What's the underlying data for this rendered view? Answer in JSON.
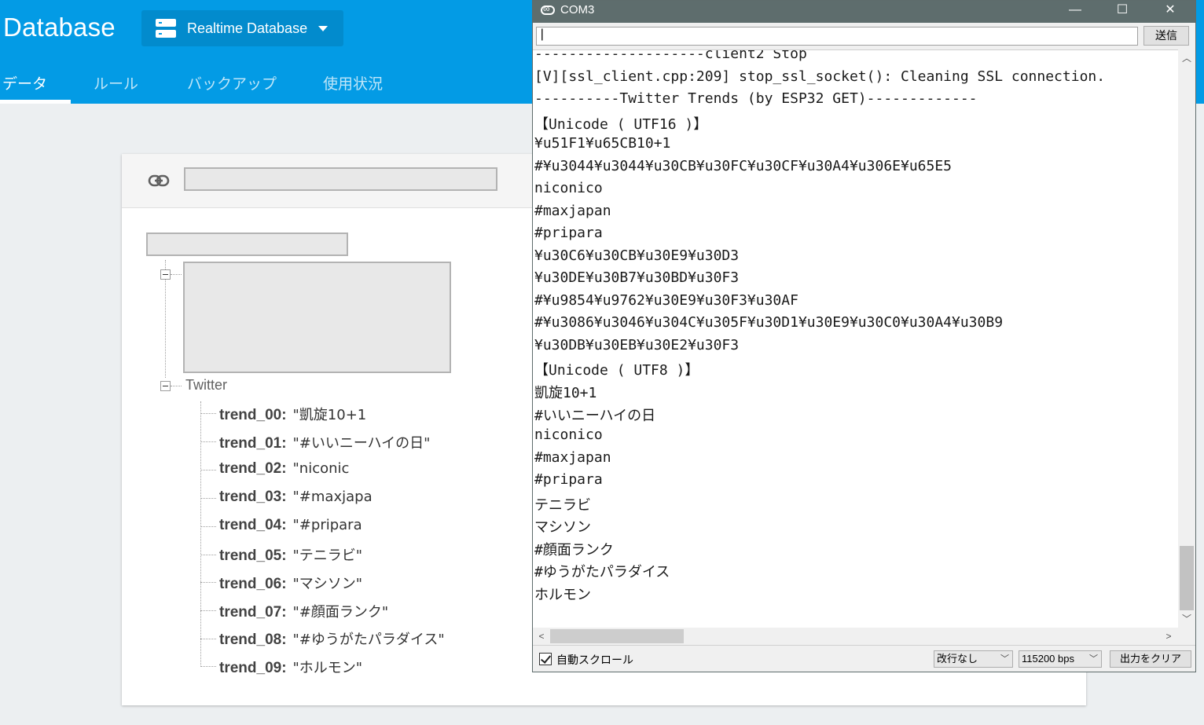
{
  "header": {
    "title": "Database",
    "db_selector": "Realtime Database",
    "tabs": [
      "データ",
      "ルール",
      "バックアップ",
      "使用状況"
    ],
    "active_tab": "データ"
  },
  "tree": {
    "node_name": "Twitter",
    "trends": [
      {
        "key": "trend_00:",
        "value": "\"凱旋10+1"
      },
      {
        "key": "trend_01:",
        "value": "\"#いいニーハイの日\""
      },
      {
        "key": "trend_02:",
        "value": "\"niconic"
      },
      {
        "key": "trend_03:",
        "value": "\"#maxjapa"
      },
      {
        "key": "trend_04:",
        "value": "\"#priparа"
      },
      {
        "key": "trend_05:",
        "value": "\"テニラビ\""
      },
      {
        "key": "trend_06:",
        "value": "\"マシソン\""
      },
      {
        "key": "trend_07:",
        "value": "\"#顔面ランク\""
      },
      {
        "key": "trend_08:",
        "value": "\"#ゆうがたパラダイス\""
      },
      {
        "key": "trend_09:",
        "value": "\"ホルモン\""
      }
    ]
  },
  "serial_monitor": {
    "title": "COM3",
    "input_value": "|",
    "send_label": "送信",
    "lines": [
      "--------------------client2 Stop",
      "[V][ssl_client.cpp:209] stop_ssl_socket(): Cleaning SSL connection.",
      "----------Twitter Trends (by ESP32 GET)-------------",
      "【Unicode ( UTF16 )】",
      "¥u51F1¥u65CB10+1",
      "#¥u3044¥u3044¥u30CB¥u30FC¥u30CF¥u30A4¥u306E¥u65E5",
      "niconico",
      "#maxjapan",
      "#pripara",
      "¥u30C6¥u30CB¥u30E9¥u30D3",
      "¥u30DE¥u30B7¥u30BD¥u30F3",
      "#¥u9854¥u9762¥u30E9¥u30F3¥u30AF",
      "#¥u3086¥u3046¥u304C¥u305F¥u30D1¥u30E9¥u30C0¥u30A4¥u30B9",
      "¥u30DB¥u30EB¥u30E2¥u30F3",
      "【Unicode ( UTF8 )】",
      "凱旋10+1",
      "#いいニーハイの日",
      "niconico",
      "#maxjapan",
      "#pripara",
      "テニラビ",
      "マシソン",
      "#顔面ランク",
      "#ゆうがたパラダイス",
      "ホルモン"
    ],
    "autoscroll_label": "自動スクロール",
    "autoscroll_checked": true,
    "line_ending": "改行なし",
    "baud_rate": "115200 bps",
    "clear_label": "出力をクリア",
    "window_buttons": [
      "—",
      "☐",
      "✕"
    ]
  },
  "colors": {
    "firebase_blue": "#039be5",
    "titlebar": "#5e6d6d"
  }
}
